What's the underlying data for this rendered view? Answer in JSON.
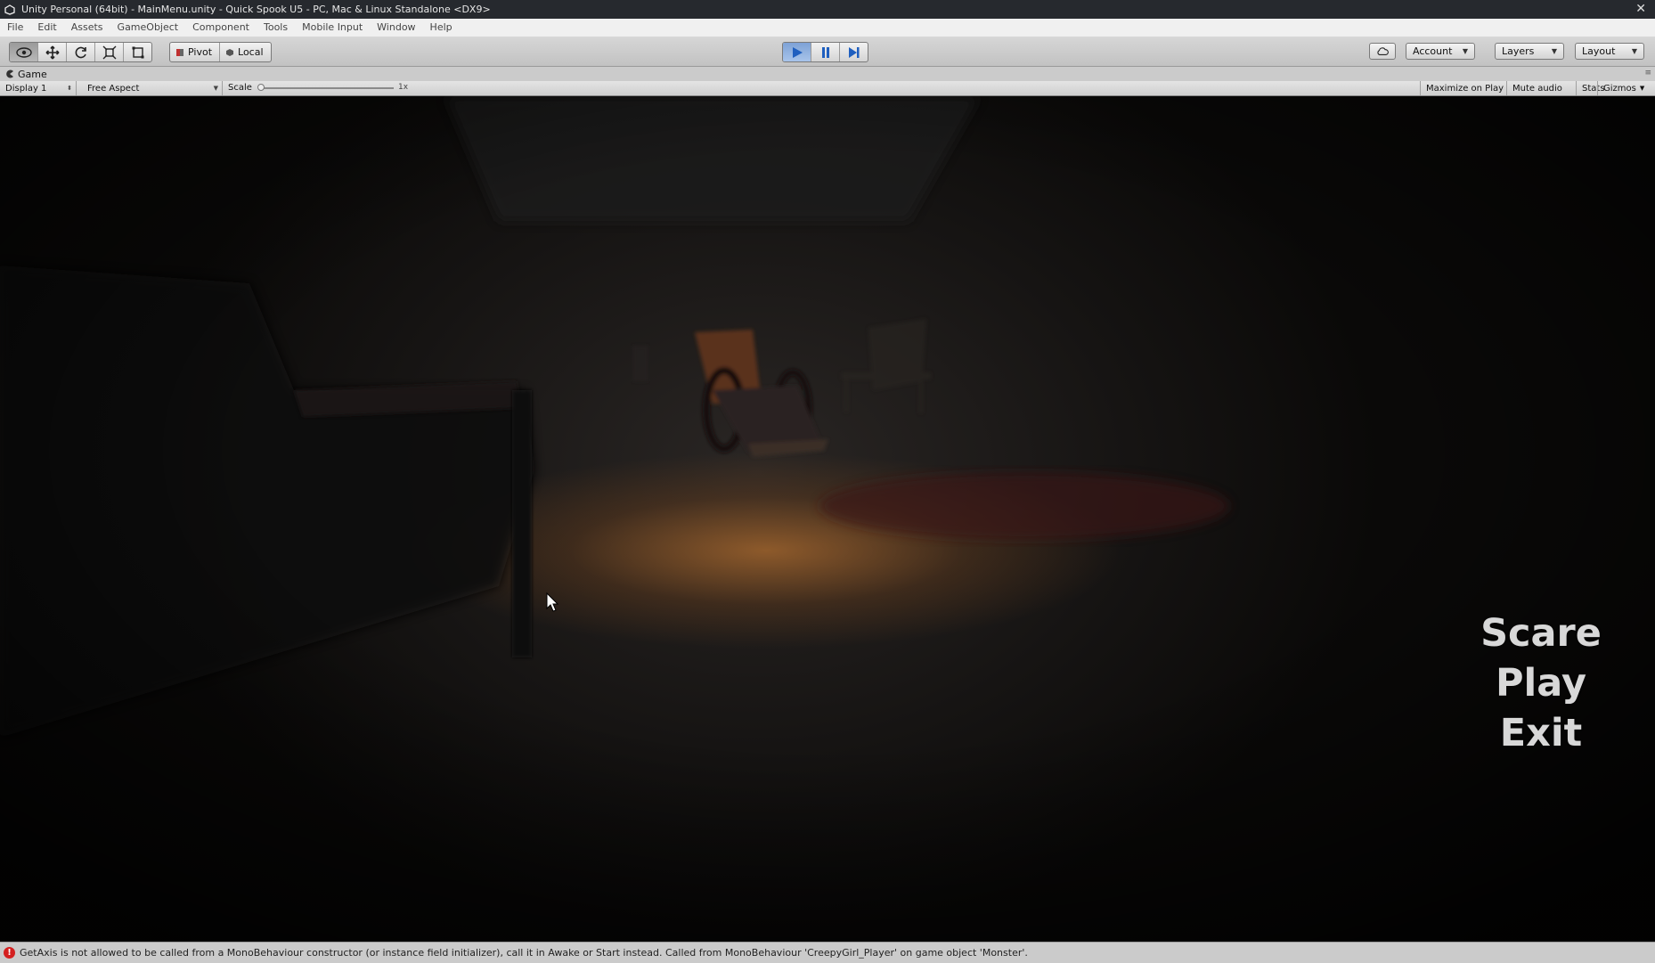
{
  "window": {
    "title": "Unity Personal (64bit) - MainMenu.unity - Quick Spook U5 - PC, Mac & Linux Standalone <DX9>",
    "close_glyph": "✕"
  },
  "menubar": {
    "items": [
      "File",
      "Edit",
      "Assets",
      "GameObject",
      "Component",
      "Tools",
      "Mobile Input",
      "Window",
      "Help"
    ]
  },
  "toolbar": {
    "transform_tools": [
      "hand-icon",
      "move-icon",
      "rotate-icon",
      "scale-icon",
      "rect-icon"
    ],
    "pivot_label": "Pivot",
    "local_label": "Local",
    "play_controls": [
      "play-icon",
      "pause-icon",
      "step-icon"
    ],
    "cloud_icon": "cloud-icon",
    "account_label": "Account",
    "layers_label": "Layers",
    "layout_label": "Layout"
  },
  "game_tab": {
    "label": "Game",
    "display_label": "Display 1",
    "aspect_label": "Free Aspect",
    "scale_label": "Scale",
    "scale_value": "1x",
    "maximize_label": "Maximize on Play",
    "mute_label": "Mute audio",
    "stats_label": "Stats",
    "gizmos_label": "Gizmos"
  },
  "game_menu": {
    "options": [
      "Scare",
      "Play",
      "Exit"
    ]
  },
  "status": {
    "message": "GetAxis is not allowed to be called from a MonoBehaviour constructor (or instance field initializer), call it in Awake or Start instead. Called from MonoBehaviour 'CreepyGirl_Player' on game object 'Monster'.",
    "icon": "error-icon",
    "icon_glyph": "!"
  },
  "colors": {
    "title_bar": "#26292e",
    "play_active": "#7ea2d6",
    "error": "#d42020",
    "menu_text": "#d8d8d8"
  }
}
